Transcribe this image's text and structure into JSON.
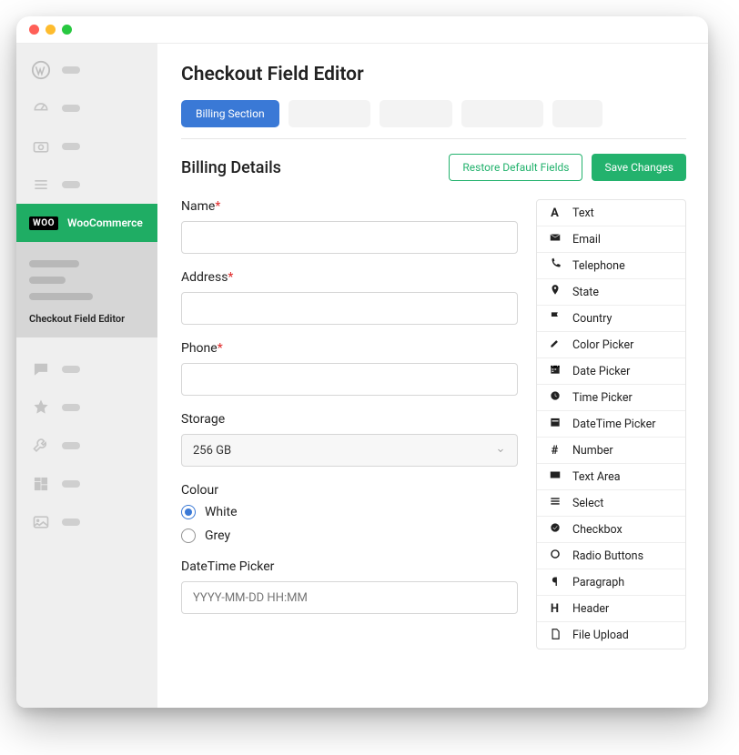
{
  "title": "Checkout Field Editor",
  "sidebar": {
    "woo_label": "WooCommerce",
    "submenu_active": "Checkout Field Editor"
  },
  "tabs": {
    "active": "Billing Section"
  },
  "section": {
    "title": "Billing Details",
    "restore_label": "Restore Default Fields",
    "save_label": "Save Changes"
  },
  "fields": {
    "name_label": "Name",
    "address_label": "Address",
    "phone_label": "Phone",
    "storage_label": "Storage",
    "storage_value": "256 GB",
    "colour_label": "Colour",
    "colour_white": "White",
    "colour_grey": "Grey",
    "datetime_label": "DateTime Picker",
    "datetime_placeholder": "YYYY-MM-DD HH:MM"
  },
  "field_types": [
    "Text",
    "Email",
    "Telephone",
    "State",
    "Country",
    "Color Picker",
    "Date Picker",
    "Time Picker",
    "DateTime Picker",
    "Number",
    "Text Area",
    "Select",
    "Checkbox",
    "Radio Buttons",
    "Paragraph",
    "Header",
    "File Upload"
  ]
}
